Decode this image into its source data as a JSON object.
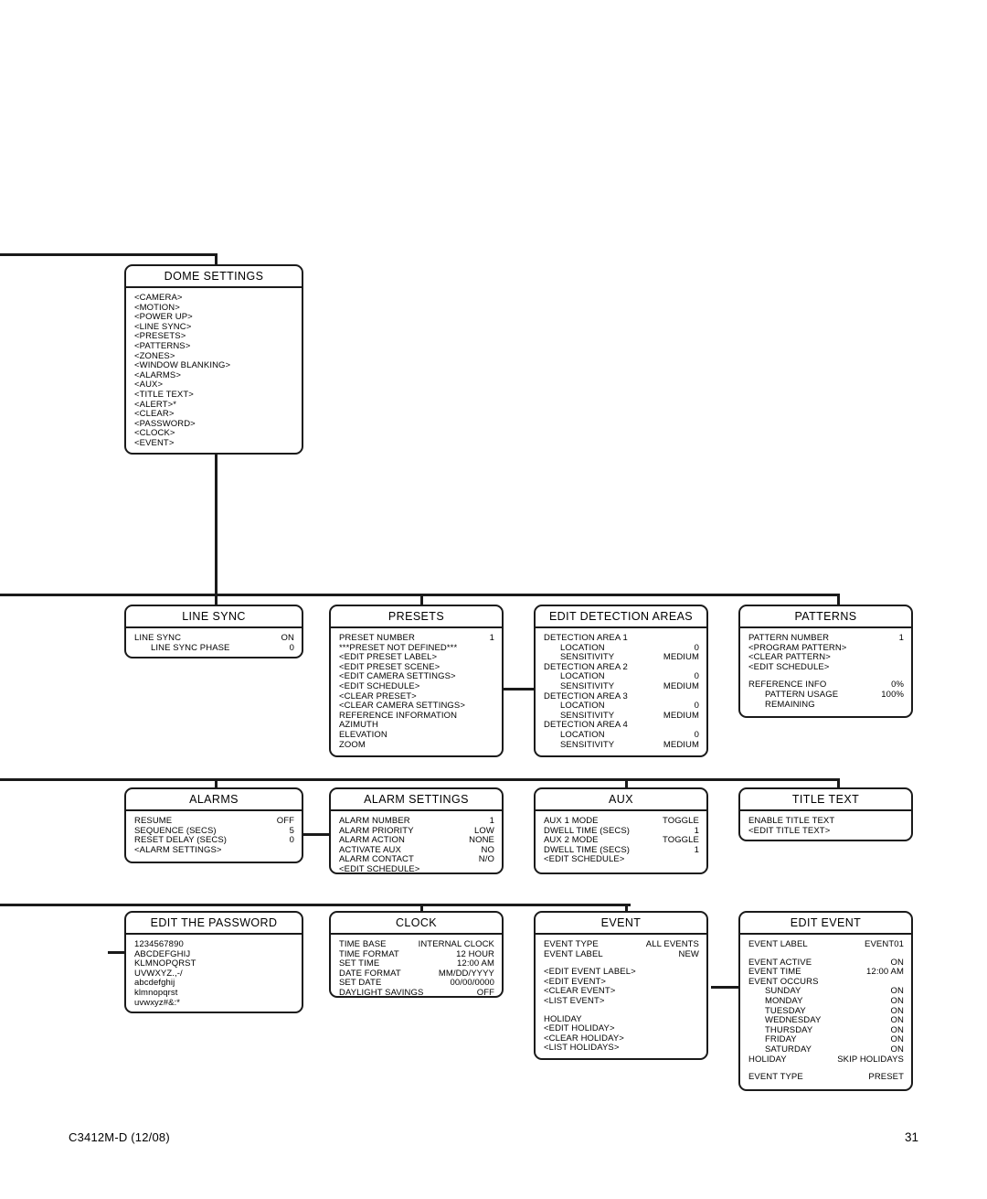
{
  "footer": {
    "document_number": "C3412M-D (12/08)",
    "page_number": "31"
  },
  "boxes": {
    "dome_settings": {
      "title": "DOME SETTINGS",
      "items": [
        "<CAMERA>",
        "<MOTION>",
        "<POWER UP>",
        "<LINE SYNC>",
        "<PRESETS>",
        "<PATTERNS>",
        "<ZONES>",
        "<WINDOW BLANKING>",
        "<ALARMS>",
        "<AUX>",
        "<TITLE TEXT>",
        "<ALERT>*",
        "<CLEAR>",
        "<PASSWORD>",
        "<CLOCK>",
        "<EVENT>"
      ]
    },
    "line_sync": {
      "title": "LINE SYNC",
      "rows": [
        {
          "label": "LINE SYNC",
          "value": "ON",
          "indent": 0
        },
        {
          "label": "LINE SYNC PHASE",
          "value": "0",
          "indent": 1
        }
      ]
    },
    "presets": {
      "title": "PRESETS",
      "rows": [
        {
          "label": "PRESET NUMBER",
          "value": "1",
          "indent": 0
        },
        {
          "label": "***PRESET NOT DEFINED***",
          "value": "",
          "indent": 0
        },
        {
          "label": "<EDIT PRESET LABEL>",
          "value": "",
          "indent": 0
        },
        {
          "label": "<EDIT PRESET SCENE>",
          "value": "",
          "indent": 0
        },
        {
          "label": "<EDIT CAMERA SETTINGS>",
          "value": "",
          "indent": 0
        },
        {
          "label": "<EDIT SCHEDULE>",
          "value": "",
          "indent": 0
        },
        {
          "label": "<CLEAR PRESET>",
          "value": "",
          "indent": 0
        },
        {
          "label": "<CLEAR CAMERA SETTINGS>",
          "value": "",
          "indent": 0
        },
        {
          "label": "REFERENCE INFORMATION",
          "value": "",
          "indent": 0
        },
        {
          "label": "AZIMUTH",
          "value": "",
          "indent": 0
        },
        {
          "label": "ELEVATION",
          "value": "",
          "indent": 0
        },
        {
          "label": "ZOOM",
          "value": "",
          "indent": 0
        }
      ]
    },
    "edit_detection_areas": {
      "title": "EDIT DETECTION AREAS",
      "rows": [
        {
          "label": "DETECTION AREA 1",
          "value": "",
          "indent": 0
        },
        {
          "label": "LOCATION",
          "value": "0",
          "indent": 1
        },
        {
          "label": "SENSITIVITY",
          "value": "MEDIUM",
          "indent": 1
        },
        {
          "label": "DETECTION AREA 2",
          "value": "",
          "indent": 0
        },
        {
          "label": "LOCATION",
          "value": "0",
          "indent": 1
        },
        {
          "label": "SENSITIVITY",
          "value": "MEDIUM",
          "indent": 1
        },
        {
          "label": "DETECTION AREA 3",
          "value": "",
          "indent": 0
        },
        {
          "label": "LOCATION",
          "value": "0",
          "indent": 1
        },
        {
          "label": "SENSITIVITY",
          "value": "MEDIUM",
          "indent": 1
        },
        {
          "label": "DETECTION AREA 4",
          "value": "",
          "indent": 0
        },
        {
          "label": "LOCATION",
          "value": "0",
          "indent": 1
        },
        {
          "label": "SENSITIVITY",
          "value": "MEDIUM",
          "indent": 1
        }
      ]
    },
    "patterns": {
      "title": "PATTERNS",
      "rows": [
        {
          "label": "PATTERN NUMBER",
          "value": "1",
          "indent": 0
        },
        {
          "label": "<PROGRAM PATTERN>",
          "value": "",
          "indent": 0
        },
        {
          "label": "<CLEAR PATTERN>",
          "value": "",
          "indent": 0
        },
        {
          "label": "<EDIT SCHEDULE>",
          "value": "",
          "indent": 0
        },
        {
          "label": "",
          "value": "",
          "indent": 0,
          "spacer": true
        },
        {
          "label": "REFERENCE INFO",
          "value": "0%",
          "indent": 0
        },
        {
          "label": "PATTERN USAGE",
          "value": "100%",
          "indent": 1
        },
        {
          "label": "REMAINING",
          "value": "",
          "indent": 1
        }
      ]
    },
    "alarms": {
      "title": "ALARMS",
      "rows": [
        {
          "label": "RESUME",
          "value": "OFF",
          "indent": 0
        },
        {
          "label": "SEQUENCE (SECS)",
          "value": "5",
          "indent": 0
        },
        {
          "label": "RESET DELAY (SECS)",
          "value": "0",
          "indent": 0
        },
        {
          "label": "<ALARM SETTINGS>",
          "value": "",
          "indent": 0
        }
      ]
    },
    "alarm_settings": {
      "title": "ALARM SETTINGS",
      "rows": [
        {
          "label": "ALARM NUMBER",
          "value": "1",
          "indent": 0
        },
        {
          "label": "ALARM PRIORITY",
          "value": "LOW",
          "indent": 0
        },
        {
          "label": "ALARM ACTION",
          "value": "NONE",
          "indent": 0
        },
        {
          "label": "ACTIVATE AUX",
          "value": "NO",
          "indent": 0
        },
        {
          "label": "ALARM CONTACT",
          "value": "N/O",
          "indent": 0
        },
        {
          "label": "<EDIT SCHEDULE>",
          "value": "",
          "indent": 0
        }
      ]
    },
    "aux": {
      "title": "AUX",
      "rows": [
        {
          "label": "AUX 1 MODE",
          "value": "TOGGLE",
          "indent": 0
        },
        {
          "label": "DWELL TIME (SECS)",
          "value": "1",
          "indent": 0
        },
        {
          "label": "AUX 2 MODE",
          "value": "TOGGLE",
          "indent": 0
        },
        {
          "label": "DWELL TIME (SECS)",
          "value": "1",
          "indent": 0
        },
        {
          "label": "<EDIT SCHEDULE>",
          "value": "",
          "indent": 0
        }
      ]
    },
    "title_text": {
      "title": "TITLE TEXT",
      "rows": [
        {
          "label": "ENABLE TITLE TEXT",
          "value": "",
          "indent": 0
        },
        {
          "label": "<EDIT TITLE TEXT>",
          "value": "",
          "indent": 0
        }
      ]
    },
    "edit_the_password": {
      "title": "EDIT THE PASSWORD",
      "items": [
        "1234567890",
        "ABCDEFGHIJ",
        "KLMNOPQRST",
        "UVWXYZ.,-/",
        "abcdefghij",
        "klmnopqrst",
        "uvwxyz#&:*"
      ]
    },
    "clock": {
      "title": "CLOCK",
      "rows": [
        {
          "label": "TIME BASE",
          "value": "INTERNAL CLOCK",
          "indent": 0
        },
        {
          "label": "TIME FORMAT",
          "value": "12 HOUR",
          "indent": 0
        },
        {
          "label": "SET TIME",
          "value": "12:00 AM",
          "indent": 0
        },
        {
          "label": "DATE FORMAT",
          "value": "MM/DD/YYYY",
          "indent": 0
        },
        {
          "label": "SET DATE",
          "value": "00/00/0000",
          "indent": 0
        },
        {
          "label": "DAYLIGHT SAVINGS",
          "value": "OFF",
          "indent": 0
        }
      ]
    },
    "event": {
      "title": "EVENT",
      "rows": [
        {
          "label": "EVENT TYPE",
          "value": "ALL EVENTS",
          "indent": 0
        },
        {
          "label": "EVENT LABEL",
          "value": "NEW",
          "indent": 0
        },
        {
          "label": "",
          "value": "",
          "indent": 0,
          "spacer": true
        },
        {
          "label": "<EDIT EVENT LABEL>",
          "value": "",
          "indent": 0
        },
        {
          "label": "<EDIT EVENT>",
          "value": "",
          "indent": 0
        },
        {
          "label": "<CLEAR EVENT>",
          "value": "",
          "indent": 0
        },
        {
          "label": "<LIST EVENT>",
          "value": "",
          "indent": 0
        },
        {
          "label": "",
          "value": "",
          "indent": 0,
          "spacer": true
        },
        {
          "label": "HOLIDAY",
          "value": "",
          "indent": 0
        },
        {
          "label": "<EDIT HOLIDAY>",
          "value": "",
          "indent": 0
        },
        {
          "label": "<CLEAR HOLIDAY>",
          "value": "",
          "indent": 0
        },
        {
          "label": "<LIST HOLIDAYS>",
          "value": "",
          "indent": 0
        }
      ]
    },
    "edit_event": {
      "title": "EDIT EVENT",
      "rows": [
        {
          "label": "EVENT LABEL",
          "value": "EVENT01",
          "indent": 0
        },
        {
          "label": "",
          "value": "",
          "indent": 0,
          "spacer": true
        },
        {
          "label": "EVENT ACTIVE",
          "value": "ON",
          "indent": 0
        },
        {
          "label": "EVENT TIME",
          "value": "12:00 AM",
          "indent": 0
        },
        {
          "label": "EVENT OCCURS",
          "value": "",
          "indent": 0
        },
        {
          "label": "SUNDAY",
          "value": "ON",
          "indent": 1
        },
        {
          "label": "MONDAY",
          "value": "ON",
          "indent": 1
        },
        {
          "label": "TUESDAY",
          "value": "ON",
          "indent": 1
        },
        {
          "label": "WEDNESDAY",
          "value": "ON",
          "indent": 1
        },
        {
          "label": "THURSDAY",
          "value": "ON",
          "indent": 1
        },
        {
          "label": "FRIDAY",
          "value": "ON",
          "indent": 1
        },
        {
          "label": "SATURDAY",
          "value": "ON",
          "indent": 1
        },
        {
          "label": "HOLIDAY",
          "value": "SKIP HOLIDAYS",
          "indent": 0
        },
        {
          "label": "",
          "value": "",
          "indent": 0,
          "spacer": true
        },
        {
          "label": "EVENT TYPE",
          "value": "PRESET",
          "indent": 0
        }
      ]
    }
  }
}
